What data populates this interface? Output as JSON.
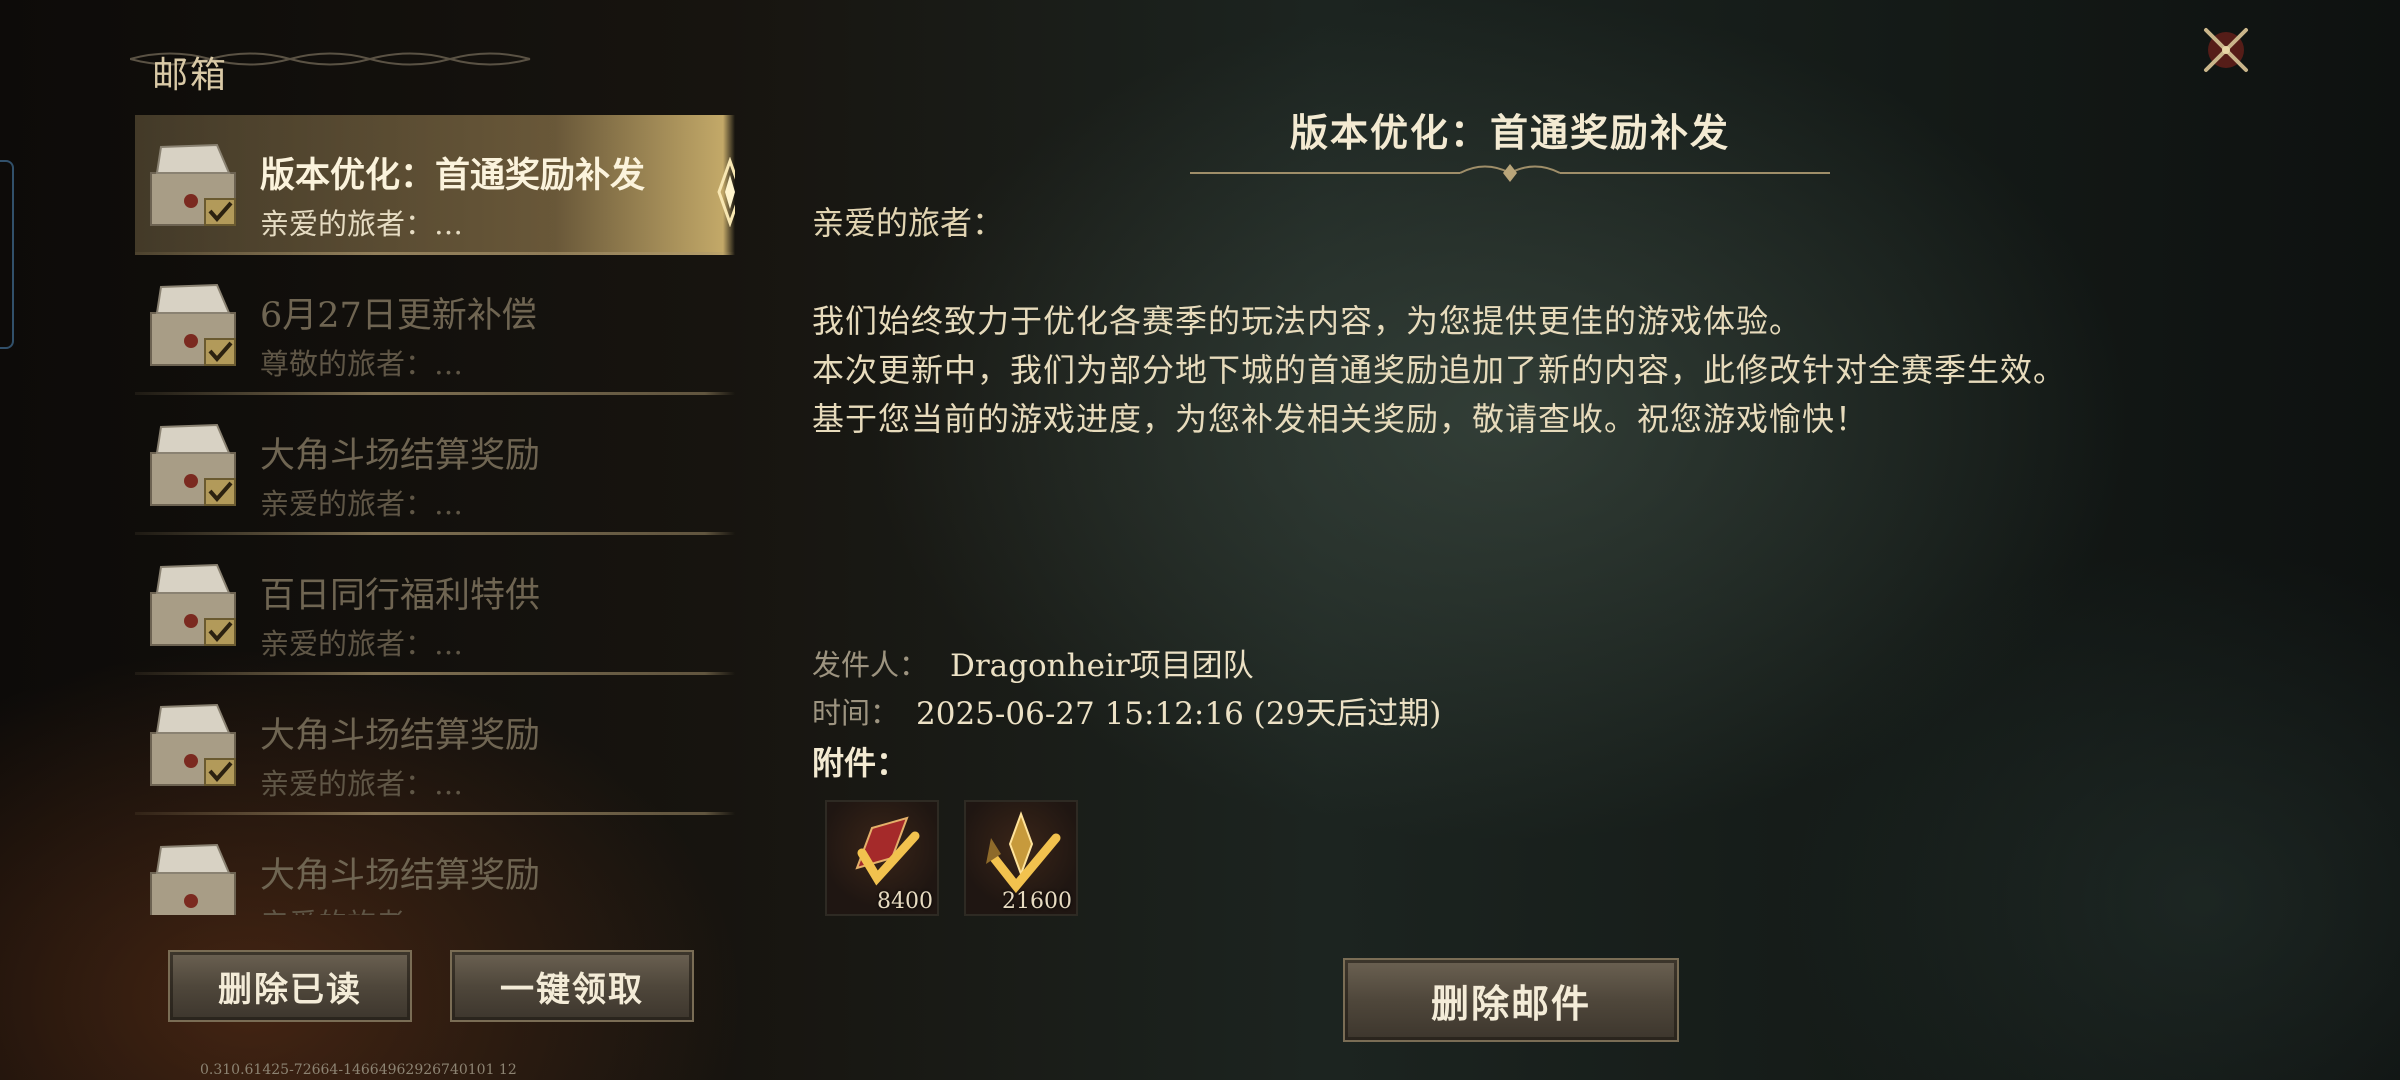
{
  "window": {
    "title": "邮箱"
  },
  "mail_list": [
    {
      "title": "版本优化：首通奖励补发",
      "preview": "亲爱的旅者：…",
      "selected": true,
      "read": true
    },
    {
      "title": "6月27日更新补偿",
      "preview": "尊敬的旅者：…",
      "selected": false,
      "read": true
    },
    {
      "title": "大角斗场结算奖励",
      "preview": "亲爱的旅者：…",
      "selected": false,
      "read": true
    },
    {
      "title": "百日同行福利特供",
      "preview": "亲爱的旅者：…",
      "selected": false,
      "read": true
    },
    {
      "title": "大角斗场结算奖励",
      "preview": "亲爱的旅者：…",
      "selected": false,
      "read": true
    },
    {
      "title": "大角斗场结算奖励",
      "preview": "亲爱的旅者：…",
      "selected": false,
      "read": true
    }
  ],
  "list_buttons": {
    "delete_read": "删除已读",
    "claim_all": "一键领取"
  },
  "detail": {
    "title": "版本优化：首通奖励补发",
    "greeting": "亲爱的旅者：",
    "body": [
      "我们始终致力于优化各赛季的玩法内容，为您提供更佳的游戏体验。",
      "本次更新中，我们为部分地下城的首通奖励追加了新的内容，此修改针对全赛季生效。",
      "基于您当前的游戏进度，为您补发相关奖励，敬请查收。祝您游戏愉快！"
    ],
    "sender_label": "发件人：",
    "sender": "Dragonheir项目团队",
    "time_label": "时间：",
    "time": "2025-06-27 15:12:16 (29天后过期)",
    "attachments_label": "附件：",
    "attachments": [
      {
        "icon": "red-crystal-icon",
        "quantity": "8400"
      },
      {
        "icon": "gold-crystal-icon",
        "quantity": "21600"
      }
    ],
    "delete_button": "删除邮件"
  },
  "version": "0.310.61425-72664-14664962926740101 12",
  "colors": {
    "accent_gold": "#e1c378",
    "text_cream": "#e7dbbc",
    "dim_text": "#6f6552"
  }
}
